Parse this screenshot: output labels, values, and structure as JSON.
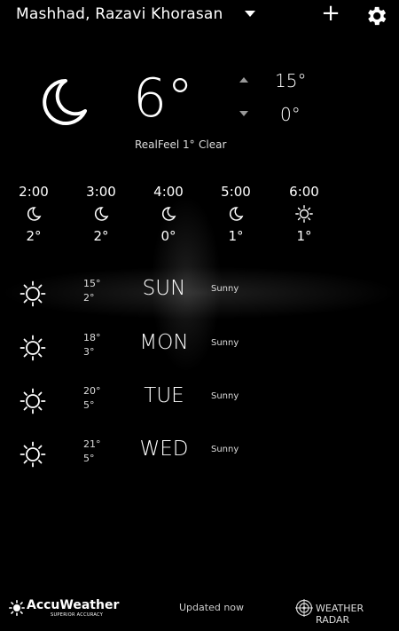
{
  "header": {
    "location": "Mashhad, Razavi Khorasan",
    "add_label": "+",
    "dropdown_icon": "caret-down-icon",
    "settings_icon": "gear-icon"
  },
  "current": {
    "icon": "moon-icon",
    "temperature": "6°",
    "high": "15°",
    "low": "0°",
    "realfeel": "RealFeel 1°",
    "condition": "Clear"
  },
  "hourly": [
    {
      "time": "2:00",
      "icon": "moon-icon",
      "temp": "2°"
    },
    {
      "time": "3:00",
      "icon": "moon-icon",
      "temp": "2°"
    },
    {
      "time": "4:00",
      "icon": "moon-icon",
      "temp": "0°"
    },
    {
      "time": "5:00",
      "icon": "moon-icon",
      "temp": "1°"
    },
    {
      "time": "6:00",
      "icon": "sun-icon",
      "temp": "1°"
    }
  ],
  "daily": [
    {
      "day": "SUN",
      "high": "15°",
      "low": "2°",
      "condition": "Sunny",
      "icon": "sun-icon"
    },
    {
      "day": "MON",
      "high": "18°",
      "low": "3°",
      "condition": "Sunny",
      "icon": "sun-icon"
    },
    {
      "day": "TUE",
      "high": "20°",
      "low": "5°",
      "condition": "Sunny",
      "icon": "sun-icon"
    },
    {
      "day": "WED",
      "high": "21°",
      "low": "5°",
      "condition": "Sunny",
      "icon": "sun-icon"
    }
  ],
  "footer": {
    "brand": "AccuWeather",
    "brand_tagline": "SUPERIOR ACCURACY",
    "updated": "Updated now",
    "radar_label": "WEATHER RADAR"
  }
}
